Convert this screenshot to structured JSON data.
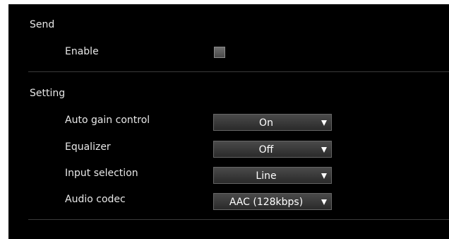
{
  "send": {
    "title": "Send",
    "enable_label": "Enable",
    "enable_checked": false
  },
  "setting": {
    "title": "Setting",
    "rows": [
      {
        "label": "Auto gain control",
        "value": "On"
      },
      {
        "label": "Equalizer",
        "value": "Off"
      },
      {
        "label": "Input selection",
        "value": "Line"
      },
      {
        "label": "Audio codec",
        "value": "AAC (128kbps)"
      }
    ]
  },
  "icons": {
    "dropdown_arrow": "chevron-down-icon"
  },
  "colors": {
    "panel_background": "#000000",
    "text": "#e8e8e8",
    "divider": "#3a3a3a"
  }
}
